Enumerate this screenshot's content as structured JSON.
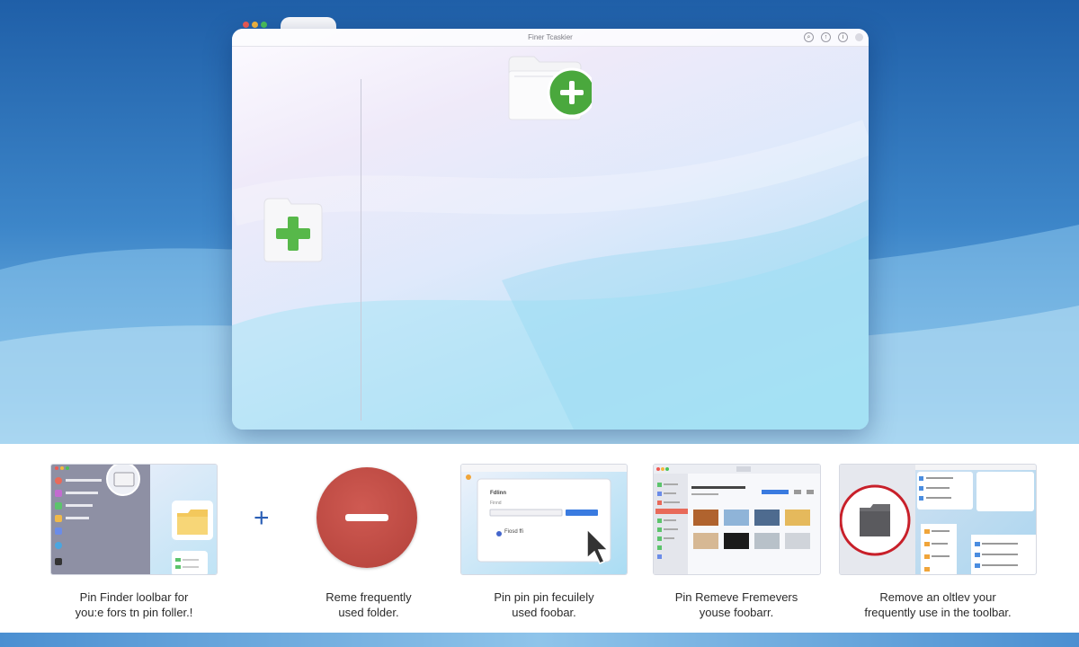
{
  "window": {
    "title": "Finer Tcaskier"
  },
  "icons": {
    "folder_add_top": "folder-plus-icon",
    "folder_add_left": "folder-plus-icon",
    "toolbar": [
      "search-icon",
      "share-icon",
      "info-icon"
    ],
    "remove": "minus-icon"
  },
  "colors": {
    "accent_green": "#5ab847",
    "remove_red": "#b9443c",
    "plus_blue": "#2b5fb6"
  },
  "tiles": [
    {
      "caption_line1": "Pin Finder loolbar for",
      "caption_line2": "you:e fors tn pin foller.!"
    },
    {
      "caption_line1": "Reme frequently",
      "caption_line2": "used folder."
    },
    {
      "caption_line1": "Pin pin pin fecuilely",
      "caption_line2": "used foobar.",
      "dialog_title": "Fdlinn",
      "dialog_label": "Finnd",
      "dialog_item": "Fiosd ffi"
    },
    {
      "caption_line1": "Pin Remeve Fremevers",
      "caption_line2": "youse foobarr."
    },
    {
      "caption_line1": "Remove an oltlev your",
      "caption_line2": "frequently use in the toolbar."
    }
  ],
  "plus_symbol": "+"
}
